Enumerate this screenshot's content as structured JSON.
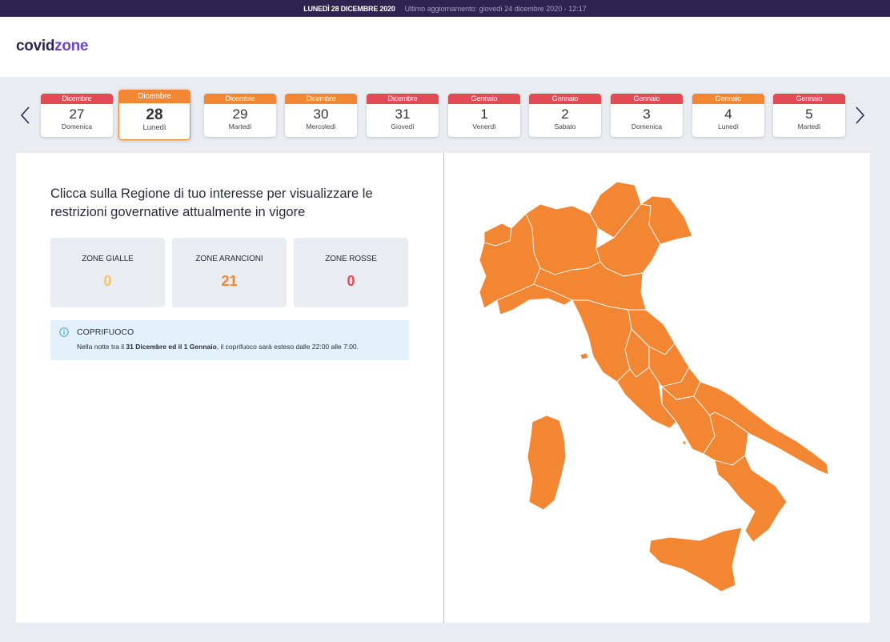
{
  "topbar": {
    "date": "LUNEDÌ 28 DICEMBRE 2020",
    "update": "Ultimo aggiornamento: giovedì 24 dicembre 2020 - 12:17"
  },
  "logo": {
    "part1": "covid",
    "part2": "zone"
  },
  "calendar": {
    "days": [
      {
        "month": "Dicembre",
        "num": "27",
        "weekday": "Domenica",
        "zone_color": "#e24b55"
      },
      {
        "month": "Dicembre",
        "num": "28",
        "weekday": "Lunedì",
        "zone_color": "#f28632",
        "selected": true
      },
      {
        "month": "Dicembre",
        "num": "29",
        "weekday": "Martedì",
        "zone_color": "#f28632"
      },
      {
        "month": "Dicembre",
        "num": "30",
        "weekday": "Mercoledì",
        "zone_color": "#f28632"
      },
      {
        "month": "Dicembre",
        "num": "31",
        "weekday": "Giovedì",
        "zone_color": "#e24b55"
      },
      {
        "month": "Gennaio",
        "num": "1",
        "weekday": "Venerdì",
        "zone_color": "#e24b55"
      },
      {
        "month": "Gennaio",
        "num": "2",
        "weekday": "Sabato",
        "zone_color": "#e24b55"
      },
      {
        "month": "Gennaio",
        "num": "3",
        "weekday": "Domenica",
        "zone_color": "#e24b55"
      },
      {
        "month": "Gennaio",
        "num": "4",
        "weekday": "Lunedì",
        "zone_color": "#f28632"
      },
      {
        "month": "Gennaio",
        "num": "5",
        "weekday": "Martedì",
        "zone_color": "#e24b55"
      }
    ],
    "prev_icon": "chevron-left-icon",
    "next_icon": "chevron-right-icon"
  },
  "intro": "Clicca sulla Regione di tuo interesse per visualizzare le restrizioni governative attualmente in vigore",
  "stats": [
    {
      "label": "ZONE GIALLE",
      "value": "0",
      "color": "#f5c26b"
    },
    {
      "label": "ZONE ARANCIONI",
      "value": "21",
      "color": "#f28632"
    },
    {
      "label": "ZONE ROSSE",
      "value": "0",
      "color": "#e24b55"
    }
  ],
  "notice": {
    "icon": "info-icon",
    "title": "COPRIFUOCO",
    "text_pre": "Nella notte tra il ",
    "text_bold": "31 Dicembre ed il 1 Gennaio",
    "text_post": ", il coprifuoco sarà esteso dalle 22:00 alle 7:00."
  },
  "map": {
    "fill": "#f28632",
    "border": "#ffffff"
  },
  "colors": {
    "topbar": "#2d2550",
    "accent": "#6a45d1",
    "orange": "#f28632",
    "red": "#e24b55",
    "yellow": "#f5c26b"
  }
}
